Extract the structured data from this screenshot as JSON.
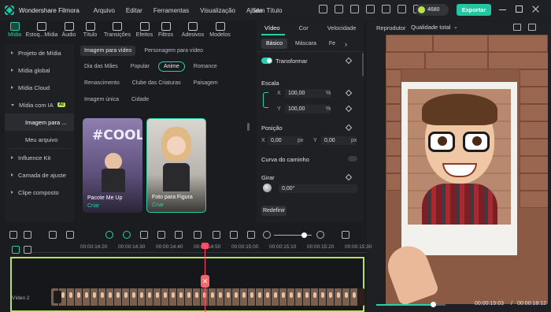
{
  "titlebar": {
    "app_name": "Wondershare Filmora",
    "menu": [
      "Arquivo",
      "Editar",
      "Ferramentas",
      "Visualização",
      "Ajuda"
    ],
    "project_title": "Sem Título",
    "credits": "4680",
    "export_label": "Exportar"
  },
  "media_tabs": [
    {
      "label": "Mídia",
      "icon": "media-icon"
    },
    {
      "label": "Estoq...Mídia",
      "icon": "stock-icon"
    },
    {
      "label": "Áudio",
      "icon": "audio-icon"
    },
    {
      "label": "Título",
      "icon": "title-icon"
    },
    {
      "label": "Transições",
      "icon": "transition-icon"
    },
    {
      "label": "Efeitos",
      "icon": "effects-icon"
    },
    {
      "label": "Filtros",
      "icon": "filters-icon"
    },
    {
      "label": "Adesivos",
      "icon": "stickers-icon"
    },
    {
      "label": "Modelos",
      "icon": "templates-icon"
    }
  ],
  "sidebar": {
    "items": [
      {
        "label": "Projeto de Mídia"
      },
      {
        "label": "Mídia global"
      },
      {
        "label": "Mídia Cloud"
      },
      {
        "label": "Mídia com IA",
        "badge": "AI"
      },
      {
        "label": "Imagem para ..."
      },
      {
        "label": "Meu arquivo"
      },
      {
        "label": "Influence Kit"
      },
      {
        "label": "Camada de ajuste"
      },
      {
        "label": "Clipe composto"
      }
    ]
  },
  "content": {
    "tabs": [
      "Imagem para vídeo",
      "Personagem para vídeo"
    ],
    "filters_row1": [
      "Dia das Mães",
      "Popular",
      "Anime",
      "Romance"
    ],
    "filters_row2": [
      "Renascimento",
      "Clube das Criaturas",
      "Paisagem"
    ],
    "filters_row3": [
      "Imagem única",
      "Cidade"
    ],
    "cards": [
      {
        "title": "Pacote Me Up",
        "action": "Criar",
        "overlay": "#COOL"
      },
      {
        "title": "Foto para Figura",
        "action": "Criar"
      }
    ]
  },
  "props": {
    "tabs": [
      "Vídeo",
      "Cor",
      "Velocidade"
    ],
    "subtabs": [
      "Básico",
      "Máscara",
      "Fe"
    ],
    "transform": "Transformar",
    "scale": "Escala",
    "x_label": "X",
    "y_label": "Y",
    "scale_x": "100,00",
    "scale_y": "100,00",
    "percent": "%",
    "position": "Posição",
    "pos_x": "0,00",
    "pos_y": "0,00",
    "px": "px",
    "path_curve": "Curva do caminho",
    "rotate": "Girar",
    "rotate_value": "0,00°",
    "refine": "Redefinir"
  },
  "player": {
    "label": "Reprodutor",
    "quality": "Qualidade total",
    "current_time": "00:00:15:03",
    "separator": "/",
    "total_time": "00:00:18:12",
    "progress": 0.82
  },
  "timeline": {
    "ticks": [
      "00:00:14:20",
      "00:00:14:30",
      "00:00:14:40",
      "00:00:14:50",
      "00:00:15:00",
      "00:00:15:10",
      "00:00:15:20",
      "00:00:15:30",
      "00:00:15:4"
    ],
    "track_label": "Vídeo 2",
    "zoom_level": 0.8
  },
  "colors": {
    "accent": "#26d0aa",
    "track_border": "#b9e44d",
    "playhead": "#ff4d6a"
  }
}
